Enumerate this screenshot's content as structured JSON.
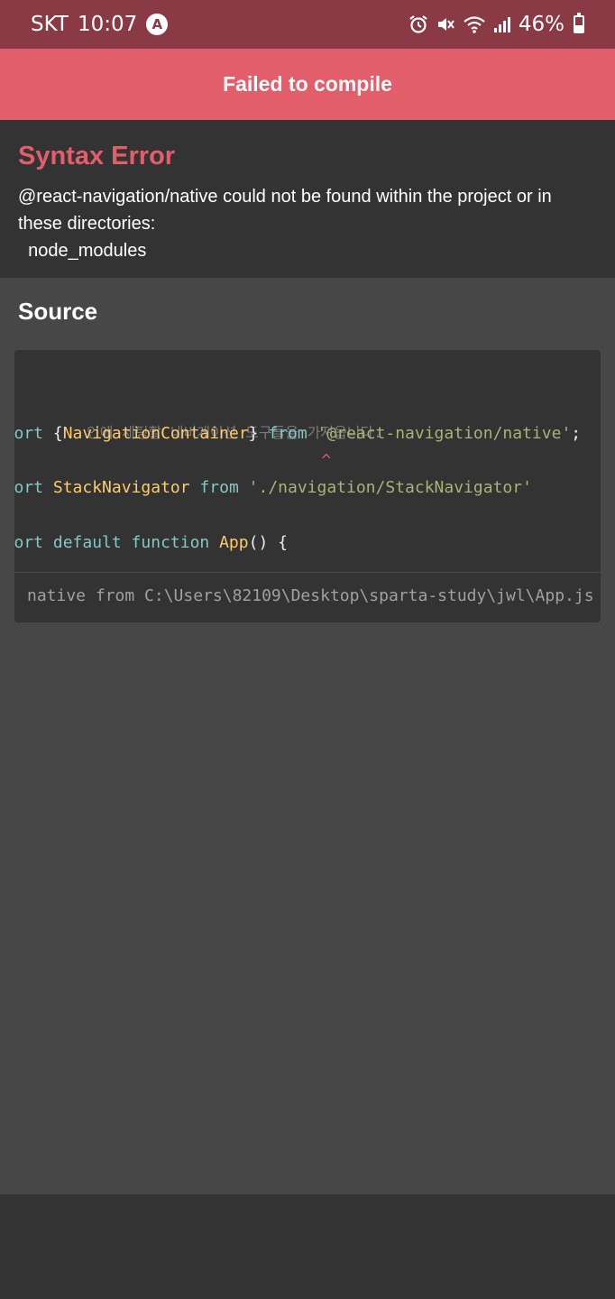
{
  "status_bar": {
    "carrier": "SKT",
    "time": "10:07",
    "app_badge": "A",
    "battery_percent": "46%",
    "battery_level": 0.46,
    "icons": [
      "alarm-icon",
      "mute-icon",
      "wifi-icon",
      "signal-icon",
      "battery-icon"
    ]
  },
  "banner": {
    "title": "Failed to compile"
  },
  "error": {
    "title": "Syntax Error",
    "message": "@react-navigation/native could not be found within the project or in these directories:\n  node_modules"
  },
  "source": {
    "title": "Source",
    "lines": {
      "comment": "인에 세팅할 네비게이션 도구들을 가져옵니다.",
      "line1": {
        "kw": "import",
        "brace_open": " {",
        "ident": "NavigationContainer",
        "brace_close": "} ",
        "from": "from",
        "space": " ",
        "str": "'@react-navigation/native'",
        "semi": ";"
      },
      "caret_line": "                            ^",
      "line2": {
        "kw": "import",
        "space1": " ",
        "ident": "StackNavigator",
        "space2": " ",
        "from": "from",
        "space3": " ",
        "str": "'./navigation/StackNavigator'"
      },
      "line3": {
        "kw": "import default function",
        "space": " ",
        "ident": "App",
        "rest": "() {"
      }
    },
    "footer": "native from C:\\Users\\82109\\Desktop\\sparta-study\\jwl\\App.js"
  },
  "colors": {
    "status_bar_bg": "#8a3a44",
    "banner_bg": "#e35e6b",
    "error_red": "#e35e6b",
    "panel_dark": "#333333",
    "panel_mid": "#474747"
  }
}
